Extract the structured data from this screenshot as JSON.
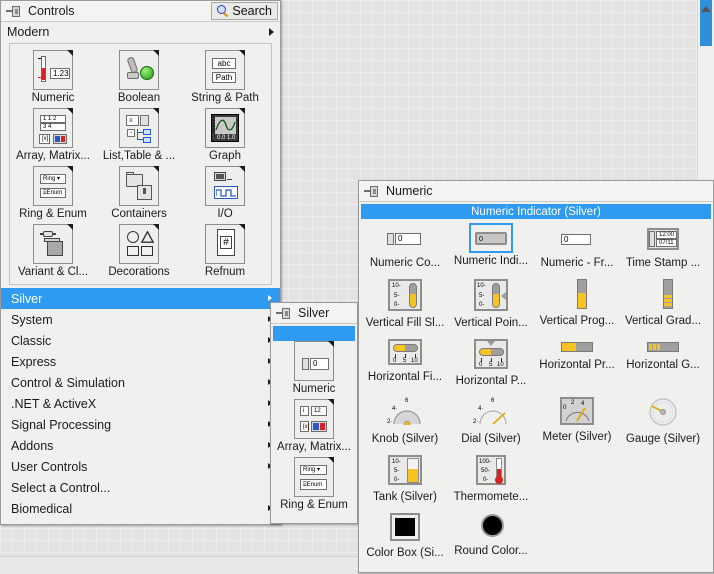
{
  "background": {
    "name": "labview-front-panel-grid",
    "grid_color": "#ededed",
    "base_color": "#e3e3e3"
  },
  "scrollbar": {
    "name": "vertical-scrollbar",
    "thumb_color": "#2f8fd8"
  },
  "controls_palette": {
    "title": "Controls",
    "pin_icon": "pin-icon",
    "search_label": "Search",
    "search_icon": "magnifier-icon",
    "modern_row_label": "Modern",
    "items": [
      {
        "label": "Numeric",
        "icon": "numeric-icon"
      },
      {
        "label": "Boolean",
        "icon": "boolean-icon"
      },
      {
        "label": "String & Path",
        "icon": "string-path-icon"
      },
      {
        "label": "Array, Matrix...",
        "icon": "array-matrix-icon"
      },
      {
        "label": "List,Table & ...",
        "icon": "list-table-icon"
      },
      {
        "label": "Graph",
        "icon": "graph-icon"
      },
      {
        "label": "Ring & Enum",
        "icon": "ring-enum-icon"
      },
      {
        "label": "Containers",
        "icon": "containers-icon"
      },
      {
        "label": "I/O",
        "icon": "io-icon"
      },
      {
        "label": "Variant & Cl...",
        "icon": "variant-class-icon"
      },
      {
        "label": "Decorations",
        "icon": "decorations-icon"
      },
      {
        "label": "Refnum",
        "icon": "refnum-icon"
      }
    ],
    "menu": [
      {
        "label": "Silver",
        "selected": true,
        "has_submenu": true
      },
      {
        "label": "System",
        "selected": false,
        "has_submenu": true
      },
      {
        "label": "Classic",
        "selected": false,
        "has_submenu": true
      },
      {
        "label": "Express",
        "selected": false,
        "has_submenu": true
      },
      {
        "label": "Control & Simulation",
        "selected": false,
        "has_submenu": true
      },
      {
        "label": ".NET & ActiveX",
        "selected": false,
        "has_submenu": true
      },
      {
        "label": "Signal Processing",
        "selected": false,
        "has_submenu": true
      },
      {
        "label": "Addons",
        "selected": false,
        "has_submenu": true
      },
      {
        "label": "User Controls",
        "selected": false,
        "has_submenu": true
      },
      {
        "label": "Select a Control...",
        "selected": false,
        "has_submenu": false
      },
      {
        "label": "Biomedical",
        "selected": false,
        "has_submenu": true
      }
    ]
  },
  "silver_palette": {
    "title": "Silver",
    "pin_icon": "pin-icon",
    "tooltip": "",
    "items": [
      {
        "label": "Numeric",
        "icon": "numeric-silver-icon"
      },
      {
        "label": "Array, Matrix...",
        "icon": "array-matrix-silver-icon"
      },
      {
        "label": "Ring & Enum",
        "icon": "ring-enum-silver-icon"
      }
    ]
  },
  "numeric_palette": {
    "title": "Numeric",
    "pin_icon": "pin-icon",
    "tooltip": "Numeric Indicator (Silver)",
    "selected_index": 1,
    "items": [
      {
        "label": "Numeric Co...",
        "icon": "numeric-control-icon"
      },
      {
        "label": "Numeric Indi...",
        "icon": "numeric-indicator-icon"
      },
      {
        "label": "Numeric - Fr...",
        "icon": "numeric-framed-icon"
      },
      {
        "label": "Time Stamp ...",
        "icon": "time-stamp-icon"
      },
      {
        "label": "Vertical Fill Sl...",
        "icon": "vertical-fill-slide-icon"
      },
      {
        "label": "Vertical Poin...",
        "icon": "vertical-pointer-slide-icon"
      },
      {
        "label": "Vertical Prog...",
        "icon": "vertical-progress-bar-icon"
      },
      {
        "label": "Vertical Grad...",
        "icon": "vertical-graduated-bar-icon"
      },
      {
        "label": "Horizontal Fi...",
        "icon": "horizontal-fill-slide-icon"
      },
      {
        "label": "Horizontal P...",
        "icon": "horizontal-pointer-slide-icon"
      },
      {
        "label": "Horizontal Pr...",
        "icon": "horizontal-progress-bar-icon"
      },
      {
        "label": "Horizontal G...",
        "icon": "horizontal-graduated-bar-icon"
      },
      {
        "label": "Knob (Silver)",
        "icon": "knob-icon"
      },
      {
        "label": "Dial (Silver)",
        "icon": "dial-icon"
      },
      {
        "label": "Meter (Silver)",
        "icon": "meter-icon"
      },
      {
        "label": "Gauge (Silver)",
        "icon": "gauge-icon"
      },
      {
        "label": "Tank (Silver)",
        "icon": "tank-icon"
      },
      {
        "label": "Thermomete...",
        "icon": "thermometer-icon"
      },
      {
        "label": "Color Box (Si...",
        "icon": "color-box-icon"
      },
      {
        "label": "Round Color...",
        "icon": "round-color-box-icon"
      }
    ],
    "icon_values": {
      "numeric_control_value": "0",
      "numeric_indicator_value": "0",
      "numeric_framed_value": "0",
      "time_stamp_time": "12:00",
      "time_stamp_date": "07/11",
      "vertical_ticks": [
        "10-",
        "5-",
        "0-"
      ],
      "horizontal_ticks": [
        "0",
        "5",
        "10"
      ],
      "knob_ticks": [
        "2",
        "4",
        "6"
      ],
      "meter_ticks": [
        "0",
        "2",
        "4"
      ],
      "tank_ticks": [
        "10-",
        "5-",
        "0-"
      ],
      "thermometer_ticks": [
        "100-",
        "50-",
        "0-"
      ]
    }
  },
  "colors": {
    "accent_blue": "#2f9bf0",
    "panel_bg": "#f0f0ee",
    "silver_yellow": "#f5c324",
    "silver_gray": "#9f9f9f",
    "thermo_red": "#d62222"
  }
}
